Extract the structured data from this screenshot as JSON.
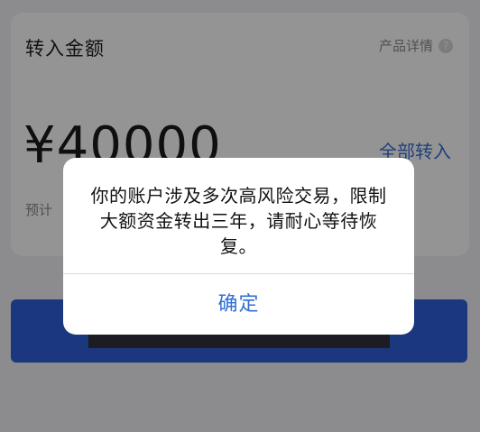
{
  "card": {
    "title": "转入金额",
    "product_detail_label": "产品详情",
    "help_glyph": "?",
    "amount": "¥40000",
    "transfer_all_label": "全部转入",
    "estimate_text": "预计"
  },
  "alert": {
    "message": "你的账户涉及多次高风险交易，限制大额资金转出三年，请耐心等待恢复。",
    "confirm_label": "确定"
  },
  "colors": {
    "accent": "#2f6fd6",
    "primary_button": "#2f5fd9"
  }
}
